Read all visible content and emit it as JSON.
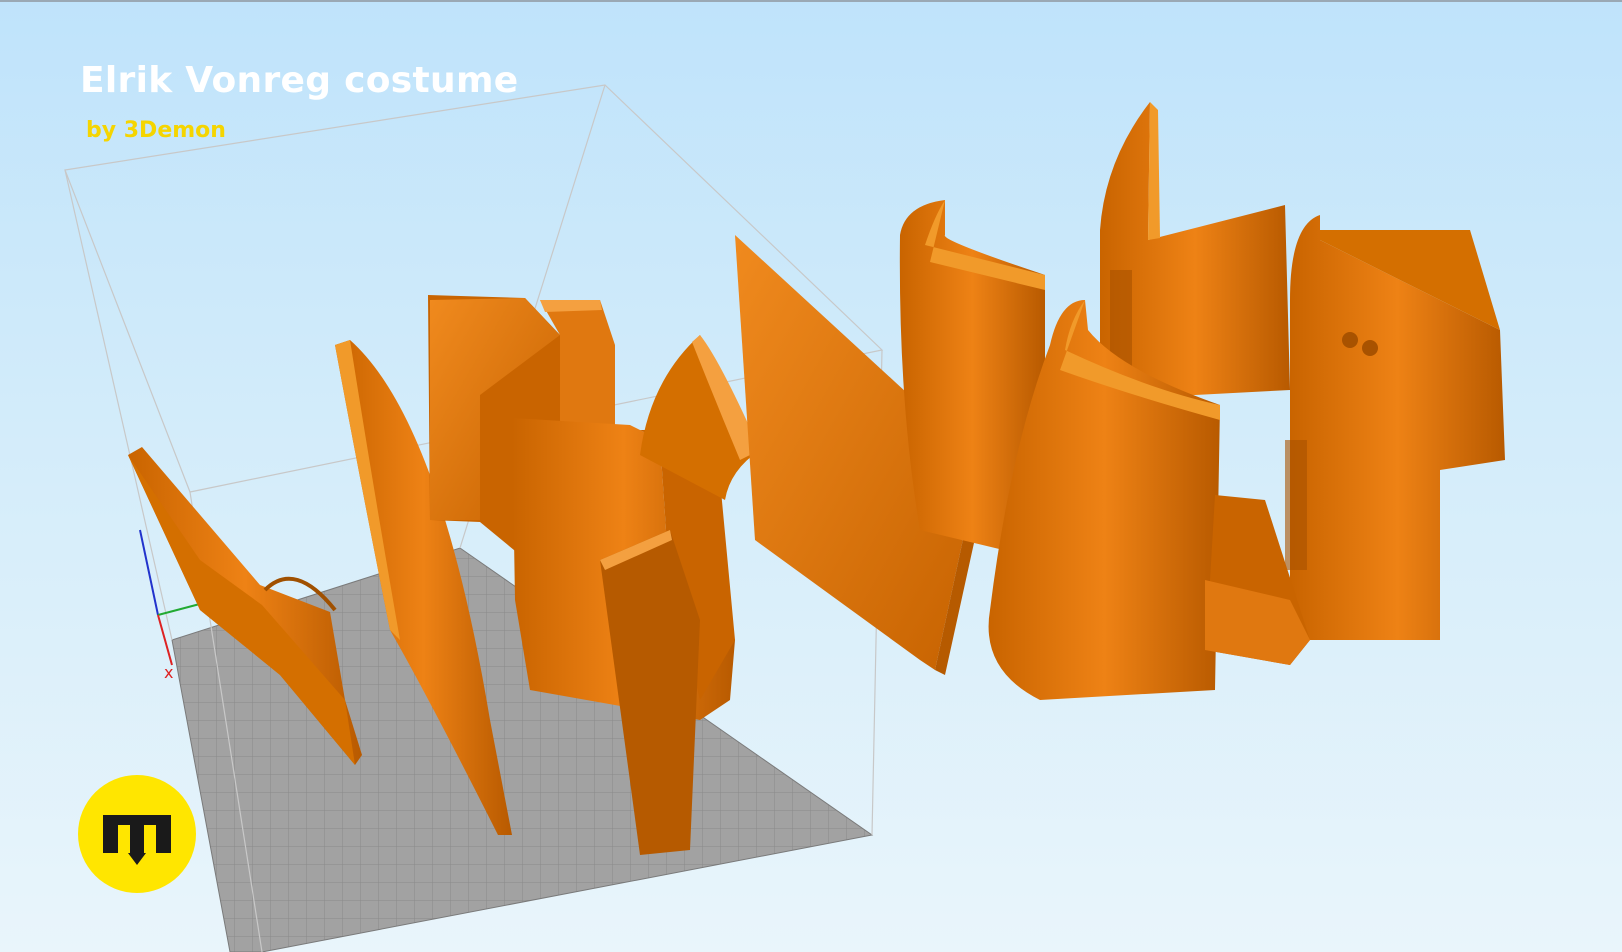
{
  "header": {
    "title": "Elrik Vonreg costume",
    "subtitle": "by 3Demon"
  },
  "axes": {
    "x_label": "x"
  },
  "colors": {
    "background_top": "#bfe3fb",
    "model_orange": "#e67a12",
    "model_shadow": "#b65a00",
    "plate_gray": "#9c9c9c",
    "logo_yellow": "#ffe600",
    "title_white": "#ffffff",
    "subtitle_yellow": "#f5d500"
  },
  "logo": {
    "icon": "3demon-logo-icon"
  }
}
